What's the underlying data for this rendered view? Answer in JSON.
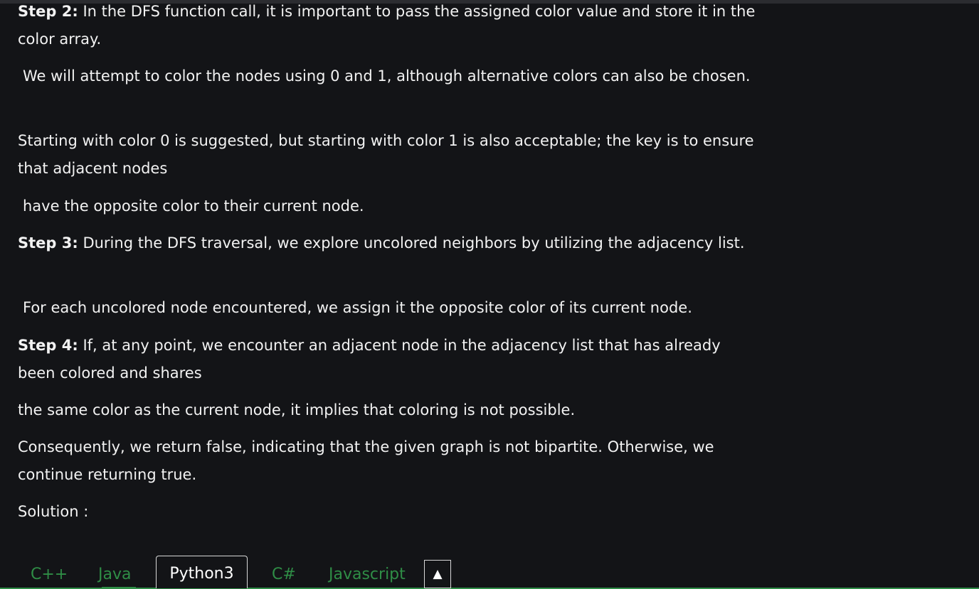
{
  "article": {
    "step2_label": "Step 2:",
    "step2_text": " In the DFS function call, it is important to pass the assigned color value and store it in the color array.",
    "colors_note": "We will attempt to color the nodes using 0 and 1, although alternative colors can also be chosen.",
    "start_color_note": "Starting with color 0 is suggested, but starting with color 1 is also acceptable; the key is to ensure that adjacent nodes",
    "opposite_color_note": "have the opposite color to their current node.",
    "step3_label": "Step 3:",
    "step3_text": " During the DFS traversal, we explore uncolored neighbors by utilizing the adjacency list.",
    "uncolored_note": "For each uncolored node encountered, we assign it the opposite color of its current node.",
    "step4_label": "Step 4:",
    "step4_text": " If, at any point, we encounter an adjacent node in the adjacency list that has already been colored and shares",
    "same_color_note": "the same color as the current node, it implies that coloring is not possible.",
    "consequence_note": "Consequently, we return false, indicating that the given graph is not bipartite. Otherwise, we continue returning true.",
    "solution_label": "Solution :"
  },
  "tabs": [
    {
      "label": "C++",
      "active": false
    },
    {
      "label": "Java",
      "active": false
    },
    {
      "label": "Python3",
      "active": true
    },
    {
      "label": "C#",
      "active": false
    },
    {
      "label": "Javascript",
      "active": false
    }
  ],
  "scroll_top_icon": "triangle-up-icon",
  "scroll_top_glyph": "▲",
  "colors": {
    "background": "#131417",
    "text": "#f2f2f2",
    "accent_green": "#2f8d46"
  }
}
